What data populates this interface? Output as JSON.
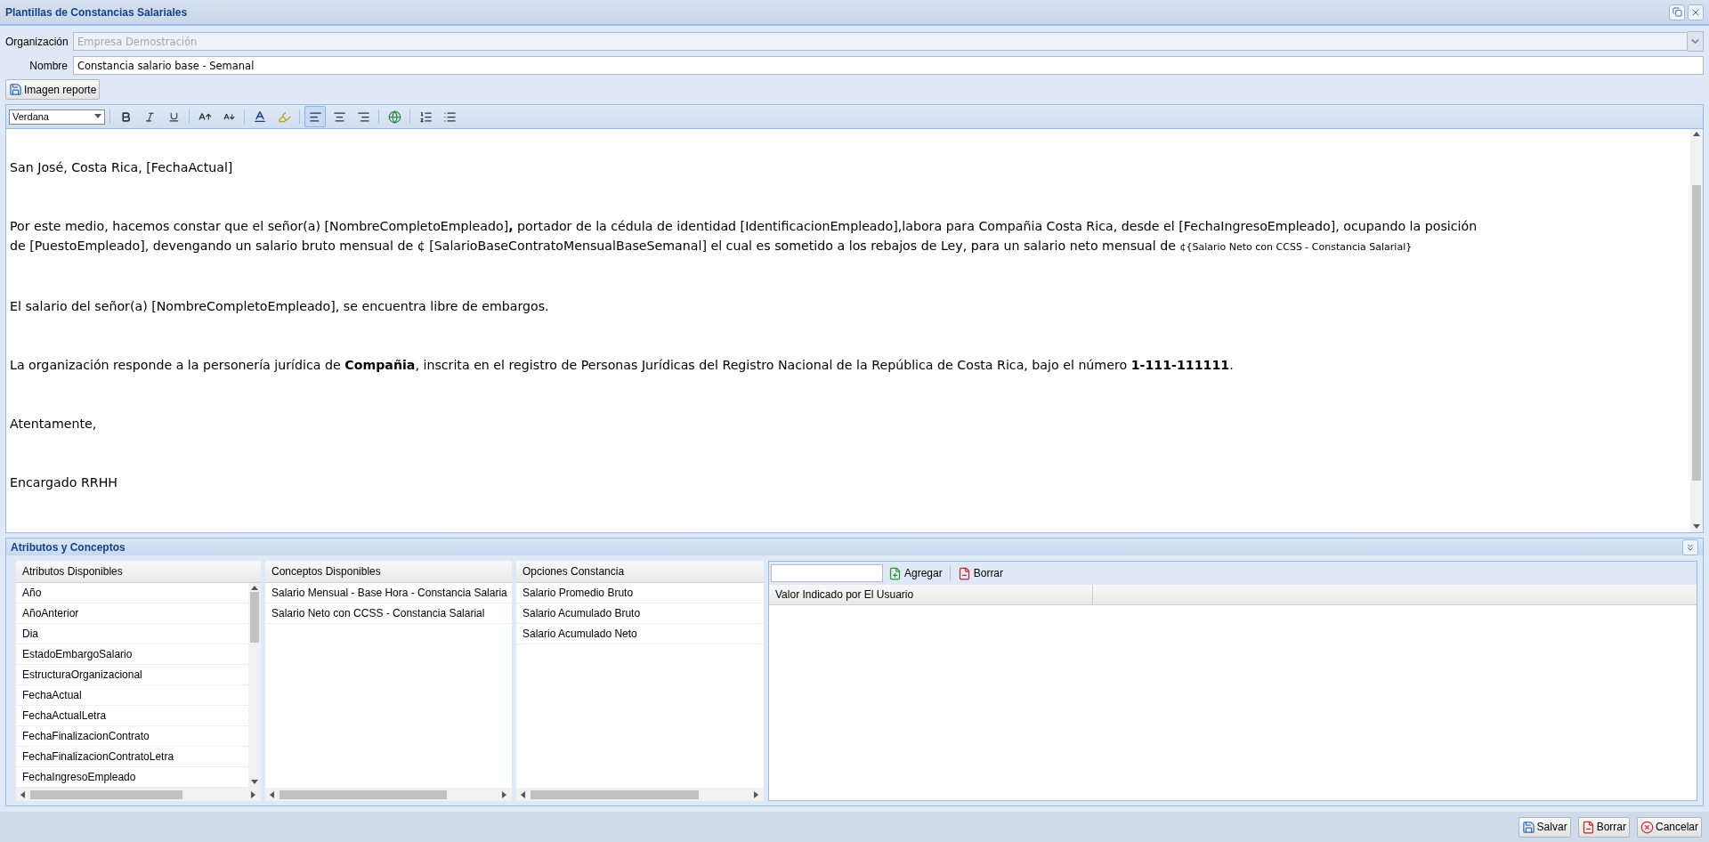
{
  "window": {
    "title": "Plantillas de Constancias Salariales"
  },
  "form": {
    "organization": {
      "label": "Organización",
      "value": "Empresa Demostración",
      "disabled": true
    },
    "name": {
      "label": "Nombre",
      "value": "Constancia salario base - Semanal"
    },
    "image_button": "Imagen reporte"
  },
  "editor": {
    "font": "Verdana",
    "alignment": [
      {
        "selected": true
      },
      {
        "selected": false
      },
      {
        "selected": false
      }
    ],
    "paragraphs": [
      {
        "text": "San José, Costa Rica, [FechaActual]"
      },
      {
        "text": "Por este medio, hacemos constar que el señor(a) [NombreCompletoEmpleado]**,** portador de la cédula de identidad [IdentificacionEmpleado],labora para Compañia Costa Rica, desde el  [FechaIngresoEmpleado], ocupando la posición de [PuestoEmpleado], devengando un salario bruto mensual de ¢ [SalarioBaseContratoMensualBaseSemanal] el cual es sometido a los rebajos de Ley, para un salario neto mensual de ",
        "small_suffix": "¢{Salario Neto con CCSS - Constancia Salarial}"
      },
      {
        "text": "El salario del señor(a) [NombreCompletoEmpleado], se encuentra libre de embargos."
      },
      {
        "text": "La organización responde a la personería jurídica de **Compañia**, inscrita en el registro de Personas Jurídicas del Registro Nacional de la República de Costa Rica, bajo el número **1-111-111111**."
      },
      {
        "text": "Atentamente,"
      },
      {
        "text": "Encargado RRHH"
      }
    ]
  },
  "lower_panel": {
    "title": "Atributos y Conceptos",
    "lists": [
      {
        "header": "Atributos Disponibles",
        "items": [
          "Año",
          "AñoAnterior",
          "Dia",
          "EstadoEmbargoSalario",
          "EstructuraOrganizacional",
          "FechaActual",
          "FechaActualLetra",
          "FechaFinalizacionContrato",
          "FechaFinalizacionContratoLetra",
          "FechaIngresoEmpleado"
        ]
      },
      {
        "header": "Conceptos Disponibles",
        "items": [
          "Salario Mensual - Base Hora - Constancia Salaria",
          "Salario Neto con CCSS - Constancia Salarial"
        ]
      },
      {
        "header": "Opciones Constancia",
        "items": [
          "Salario Promedio Bruto",
          "Salario Acumulado Bruto",
          "Salario Acumulado Neto"
        ]
      }
    ],
    "values_grid": {
      "add_button": "Agregar",
      "delete_button": "Borrar",
      "columns": [
        "Valor Indicado por El Usuario"
      ]
    }
  },
  "footer_buttons": [
    {
      "kind": "save",
      "label": "Salvar"
    },
    {
      "kind": "delete",
      "label": "Borrar"
    },
    {
      "kind": "cancel",
      "label": "Cancelar"
    }
  ]
}
